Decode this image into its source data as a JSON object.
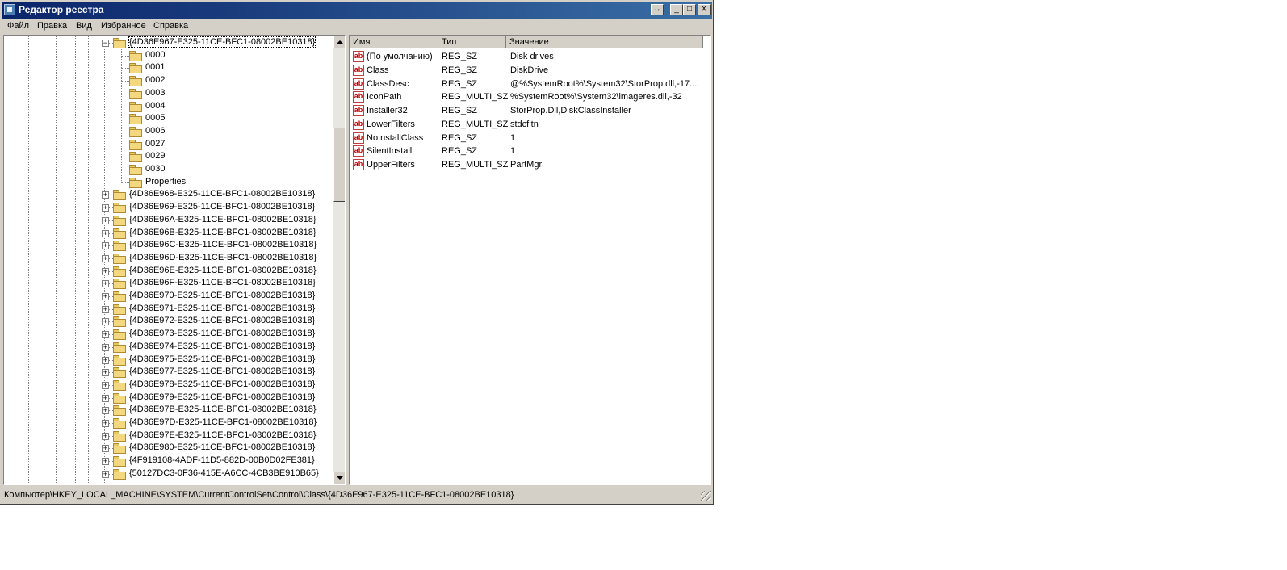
{
  "window": {
    "title": "Редактор реестра",
    "buttons": {
      "restore_down": "↔",
      "minimize": "_",
      "maximize": "□",
      "close": "X"
    }
  },
  "menu": [
    "Файл",
    "Правка",
    "Вид",
    "Избранное",
    "Справка"
  ],
  "tree": {
    "selected": "{4D36E967-E325-11CE-BFC1-08002BE10318}",
    "children": [
      "0000",
      "0001",
      "0002",
      "0003",
      "0004",
      "0005",
      "0006",
      "0027",
      "0029",
      "0030",
      "Properties"
    ],
    "siblings": [
      "{4D36E968-E325-11CE-BFC1-08002BE10318}",
      "{4D36E969-E325-11CE-BFC1-08002BE10318}",
      "{4D36E96A-E325-11CE-BFC1-08002BE10318}",
      "{4D36E96B-E325-11CE-BFC1-08002BE10318}",
      "{4D36E96C-E325-11CE-BFC1-08002BE10318}",
      "{4D36E96D-E325-11CE-BFC1-08002BE10318}",
      "{4D36E96E-E325-11CE-BFC1-08002BE10318}",
      "{4D36E96F-E325-11CE-BFC1-08002BE10318}",
      "{4D36E970-E325-11CE-BFC1-08002BE10318}",
      "{4D36E971-E325-11CE-BFC1-08002BE10318}",
      "{4D36E972-E325-11CE-BFC1-08002BE10318}",
      "{4D36E973-E325-11CE-BFC1-08002BE10318}",
      "{4D36E974-E325-11CE-BFC1-08002BE10318}",
      "{4D36E975-E325-11CE-BFC1-08002BE10318}",
      "{4D36E977-E325-11CE-BFC1-08002BE10318}",
      "{4D36E978-E325-11CE-BFC1-08002BE10318}",
      "{4D36E979-E325-11CE-BFC1-08002BE10318}",
      "{4D36E97B-E325-11CE-BFC1-08002BE10318}",
      "{4D36E97D-E325-11CE-BFC1-08002BE10318}",
      "{4D36E97E-E325-11CE-BFC1-08002BE10318}",
      "{4D36E980-E325-11CE-BFC1-08002BE10318}",
      "{4F919108-4ADF-11D5-882D-00B0D02FE381}",
      "{50127DC3-0F36-415E-A6CC-4CB3BE910B65}"
    ]
  },
  "values_table": {
    "columns": [
      "Имя",
      "Тип",
      "Значение"
    ],
    "rows": [
      {
        "name": "(По умолчанию)",
        "type": "REG_SZ",
        "value": "Disk drives"
      },
      {
        "name": "Class",
        "type": "REG_SZ",
        "value": "DiskDrive"
      },
      {
        "name": "ClassDesc",
        "type": "REG_SZ",
        "value": "@%SystemRoot%\\System32\\StorProp.dll,-17..."
      },
      {
        "name": "IconPath",
        "type": "REG_MULTI_SZ",
        "value": "%SystemRoot%\\System32\\imageres.dll,-32"
      },
      {
        "name": "Installer32",
        "type": "REG_SZ",
        "value": "StorProp.Dll,DiskClassInstaller"
      },
      {
        "name": "LowerFilters",
        "type": "REG_MULTI_SZ",
        "value": "stdcfltn"
      },
      {
        "name": "NoInstallClass",
        "type": "REG_SZ",
        "value": "1"
      },
      {
        "name": "SilentInstall",
        "type": "REG_SZ",
        "value": "1"
      },
      {
        "name": "UpperFilters",
        "type": "REG_MULTI_SZ",
        "value": "PartMgr"
      }
    ],
    "icon_text": "ab"
  },
  "status": "Компьютер\\HKEY_LOCAL_MACHINE\\SYSTEM\\CurrentControlSet\\Control\\Class\\{4D36E967-E325-11CE-BFC1-08002BE10318}"
}
